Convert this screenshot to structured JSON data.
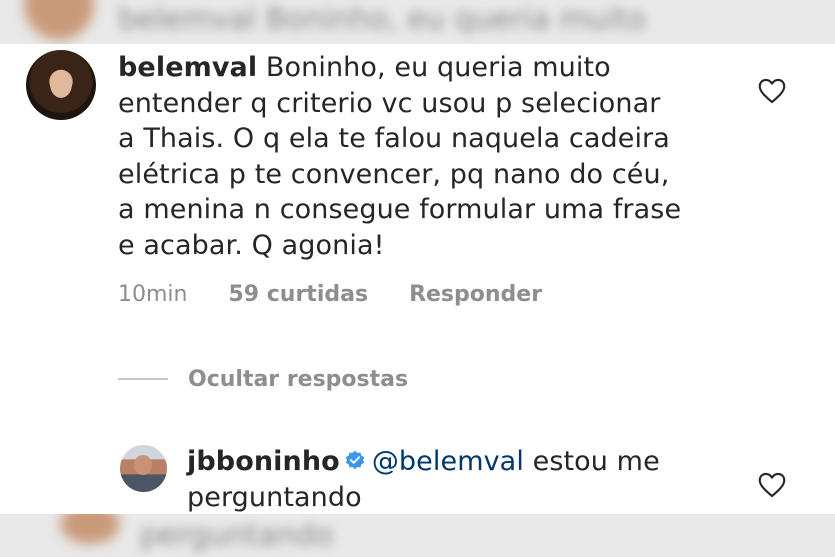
{
  "blurred": {
    "top_text": "belemval Boninho, eu queria muito",
    "bottom_text": "perguntando"
  },
  "comment": {
    "avatar_icon": "user-avatar-woman",
    "username": "belemval",
    "lines": [
      "Boninho, eu queria muito",
      "entender q criterio vc usou p selecionar",
      "a Thais. O q ela te falou naquela cadeira",
      "elétrica p te convencer, pq nano do céu,",
      "a menina n consegue formular uma frase",
      "e acabar. Q agonia!"
    ],
    "time": "10min",
    "likes": "59 curtidas",
    "reply_label": "Responder",
    "like_icon": "heart-outline-icon"
  },
  "hide_replies_label": "Ocultar respostas",
  "reply": {
    "avatar_icon": "user-avatar-man",
    "username": "jbboninho",
    "verified_icon": "verified-badge-icon",
    "verified_color": "#3897f0",
    "mention": "@belemval",
    "text_line1": " estou me",
    "text_line2": "perguntando",
    "like_icon": "heart-outline-icon"
  }
}
